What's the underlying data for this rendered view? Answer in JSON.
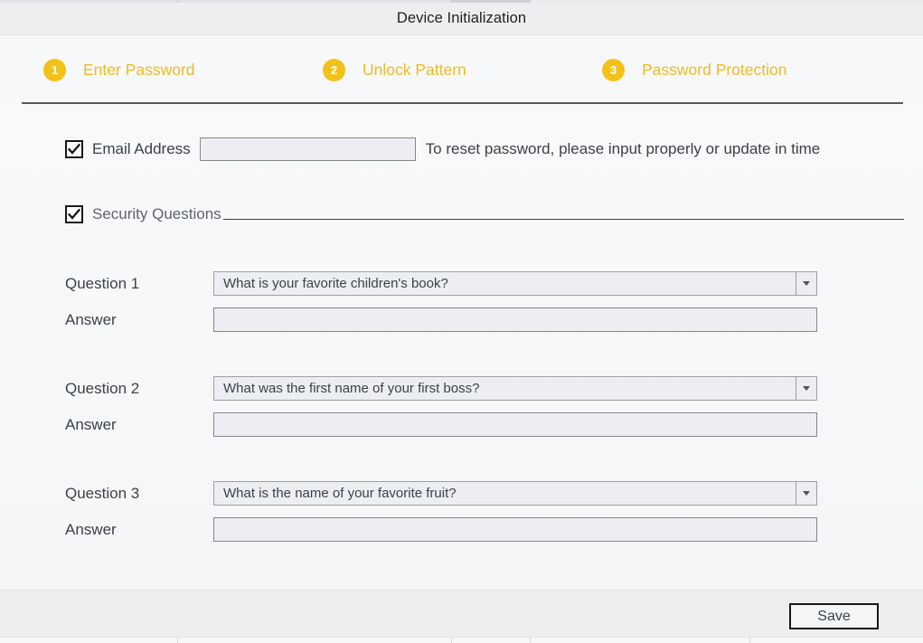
{
  "window": {
    "title": "Device Initialization"
  },
  "steps": [
    {
      "number": "1",
      "label": "Enter Password"
    },
    {
      "number": "2",
      "label": "Unlock Pattern"
    },
    {
      "number": "3",
      "label": "Password Protection"
    }
  ],
  "email": {
    "checkbox_checked": true,
    "label": "Email Address",
    "value": "",
    "placeholder": "",
    "hint": "To reset password, please input properly or update in time"
  },
  "security_questions": {
    "checkbox_checked": true,
    "label": "Security Questions",
    "items": [
      {
        "question_label": "Question 1",
        "question_value": "What is your favorite children's book?",
        "answer_label": "Answer",
        "answer_value": "",
        "answer_placeholder": ""
      },
      {
        "question_label": "Question 2",
        "question_value": "What was the first name of your first boss?",
        "answer_label": "Answer",
        "answer_value": "",
        "answer_placeholder": ""
      },
      {
        "question_label": "Question 3",
        "question_value": "What is the name of your favorite fruit?",
        "answer_label": "Answer",
        "answer_value": "",
        "answer_placeholder": ""
      }
    ]
  },
  "footer": {
    "save_label": "Save"
  },
  "icons": {
    "checkmark": "check-icon",
    "dropdown": "chevron-down-icon"
  },
  "colors": {
    "accent": "#f0bb22",
    "badge": "#f2c219",
    "text": "#3c4248",
    "field_fill": "#eceef2",
    "divider": "#53585e"
  }
}
